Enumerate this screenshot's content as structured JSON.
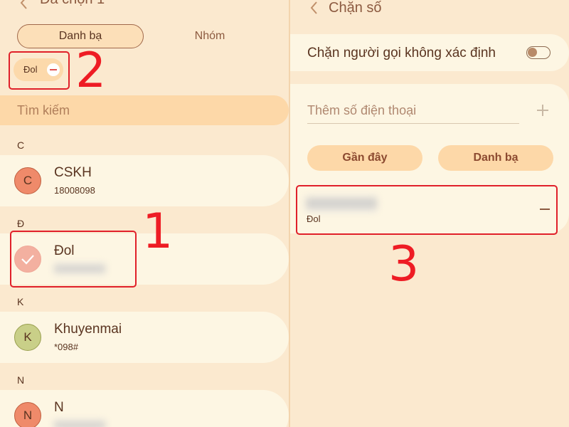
{
  "left": {
    "header_title": "Đã chọn 1",
    "tabs": [
      {
        "label": "Danh bạ"
      },
      {
        "label": "Nhóm"
      }
    ],
    "selected_chip": {
      "label": "Đol"
    },
    "search": {
      "placeholder": "Tìm kiếm"
    },
    "sections": [
      {
        "letter": "C",
        "contact": {
          "initial": "C",
          "name": "CSKH",
          "number": "18008098",
          "avatar_color": "#ef8a6a"
        }
      },
      {
        "letter": "Đ",
        "contact": {
          "initial": "",
          "name": "Đol",
          "number": "0000000000",
          "avatar_color": "#f3b0a0",
          "selected": true
        }
      },
      {
        "letter": "K",
        "contact": {
          "initial": "K",
          "name": "Khuyenmai",
          "number": "*098#",
          "avatar_color": "#c9cf88"
        }
      },
      {
        "letter": "N",
        "contact": {
          "initial": "N",
          "name": "N",
          "number": "0000000000",
          "avatar_color": "#ef8a6a"
        }
      }
    ]
  },
  "right": {
    "header_title": "Chặn số",
    "block_unknown": {
      "label": "Chặn người gọi không xác định",
      "enabled": false
    },
    "add_number": {
      "placeholder": "Thêm số điện thoại"
    },
    "buttons": {
      "recent": "Gần đây",
      "contacts": "Danh bạ"
    },
    "blocked_list": [
      {
        "number": "0000000000",
        "name": "Đol"
      }
    ]
  },
  "annotations": [
    "1",
    "2",
    "3"
  ],
  "colors": {
    "accent": "#ee1c24",
    "background": "#fbe9cf",
    "card": "#fdf6e3",
    "pill": "#fdd8a8"
  }
}
